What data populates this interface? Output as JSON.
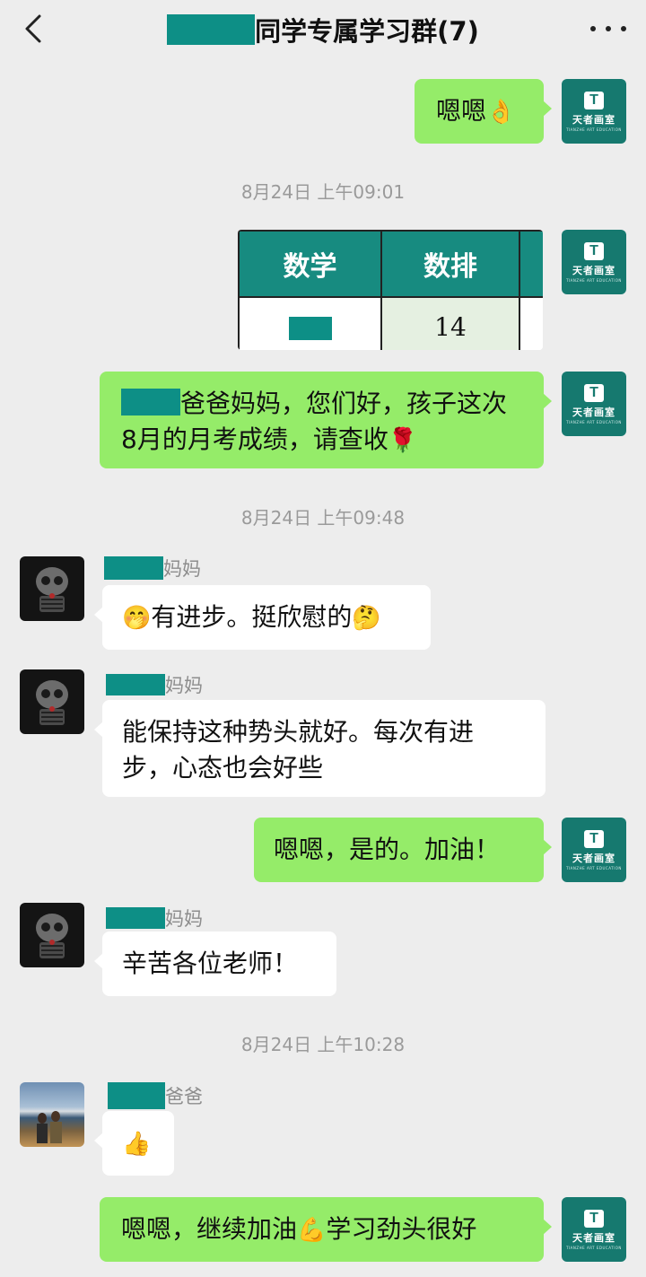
{
  "header": {
    "title": "同学专属学习群(7)"
  },
  "brand_avatar": {
    "name": "天者画室",
    "sub": "TIANZHE ART EDUCATION"
  },
  "messages": {
    "m1": {
      "text": "嗯嗯",
      "emoji": "👌"
    },
    "t1": "8月24日 上午09:01",
    "score_table": {
      "headers": [
        "数学",
        "数排",
        ""
      ],
      "row": [
        "",
        "14",
        ""
      ]
    },
    "m2": {
      "text": "爸爸妈妈，您们好，孩子这次",
      "line2": "8月的月考成绩，请查收",
      "emoji": "🌹"
    },
    "t2": "8月24日 上午09:48",
    "m3": {
      "sender": "妈妈",
      "emoji_start": "🤭",
      "text": "有进步。挺欣慰的",
      "emoji_end": "🤔"
    },
    "m4": {
      "sender": "妈妈",
      "text": "能保持这种势头就好。每次有进",
      "line2": "步，心态也会好些"
    },
    "m5": {
      "text": "嗯嗯，是的。加油！"
    },
    "m6": {
      "sender": "妈妈",
      "text": "辛苦各位老师！"
    },
    "t3": "8月24日 上午10:28",
    "m7": {
      "sender": "爸爸",
      "emoji": "👍"
    },
    "m8": {
      "text": "嗯嗯，继续加油",
      "emoji": "💪",
      "text2": "学习劲头很好"
    }
  },
  "colors": {
    "sent_bubble": "#95ec69",
    "recv_bubble": "#ffffff",
    "redaction": "#0d8f86",
    "brand": "#16796f"
  },
  "icons": [
    "back-arrow-icon",
    "more-dots-icon"
  ]
}
